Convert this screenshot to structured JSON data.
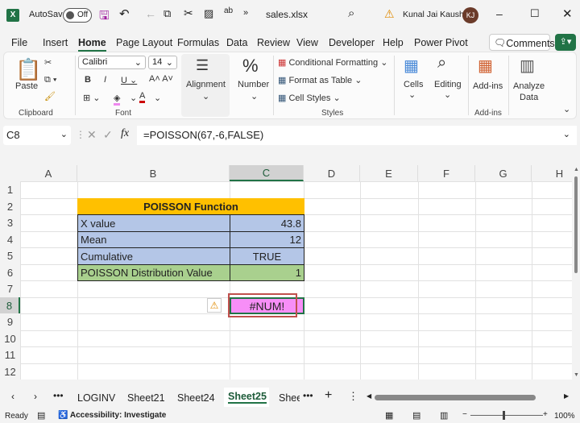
{
  "titlebar": {
    "app_icon": "X",
    "autosave_label": "AutoSave",
    "autosave_state": "Off",
    "filename": "sales.xlsx",
    "user": "Kunal Jai Kaushik",
    "initials": "KJ"
  },
  "menu": {
    "items": [
      "File",
      "Insert",
      "Home",
      "Page Layout",
      "Formulas",
      "Data",
      "Review",
      "View",
      "Developer",
      "Help",
      "Power Pivot"
    ],
    "active": "Home",
    "comments": "Comments"
  },
  "ribbon": {
    "paste": "Paste",
    "clipboard": "Clipboard",
    "font_name": "Calibri",
    "font_size": "14",
    "font": "Font",
    "alignment": "Alignment",
    "number": "Number",
    "conditional_formatting": "Conditional Formatting",
    "format_as_table": "Format as Table",
    "cell_styles": "Cell Styles",
    "styles": "Styles",
    "cells": "Cells",
    "editing": "Editing",
    "addins": "Add-ins",
    "addins_group": "Add-ins",
    "analyze_line1": "Analyze",
    "analyze_line2": "Data"
  },
  "formula_bar": {
    "name_box": "C8",
    "fx": "fx",
    "formula": "=POISSON(67,-6,FALSE)"
  },
  "columns": [
    "A",
    "B",
    "C",
    "D",
    "E",
    "F",
    "G",
    "H"
  ],
  "rows": [
    "1",
    "2",
    "3",
    "4",
    "5",
    "6",
    "7",
    "8",
    "9",
    "10",
    "11",
    "12"
  ],
  "cells": {
    "title": "POISSON Function",
    "x_label": "X value",
    "x_value": "43.8",
    "mean_label": "Mean",
    "mean_value": "12",
    "cumulative_label": "Cumulative",
    "cumulative_value": "TRUE",
    "result_label": "POISSON Distribution Value",
    "result_value": "1",
    "error_value": "#NUM!"
  },
  "colors": {
    "title_bg": "#ffc000",
    "blue_bg": "#b4c6e7",
    "green_bg": "#a9d08e",
    "error_bg": "#f78ef7",
    "accent": "#217346"
  },
  "sheets": {
    "tabs": [
      "LOGINV",
      "Sheet21",
      "Sheet24",
      "Sheet25",
      "Shee"
    ],
    "active": "Sheet25"
  },
  "status": {
    "ready": "Ready",
    "accessibility": "Accessibility: Investigate",
    "zoom": "100%"
  }
}
